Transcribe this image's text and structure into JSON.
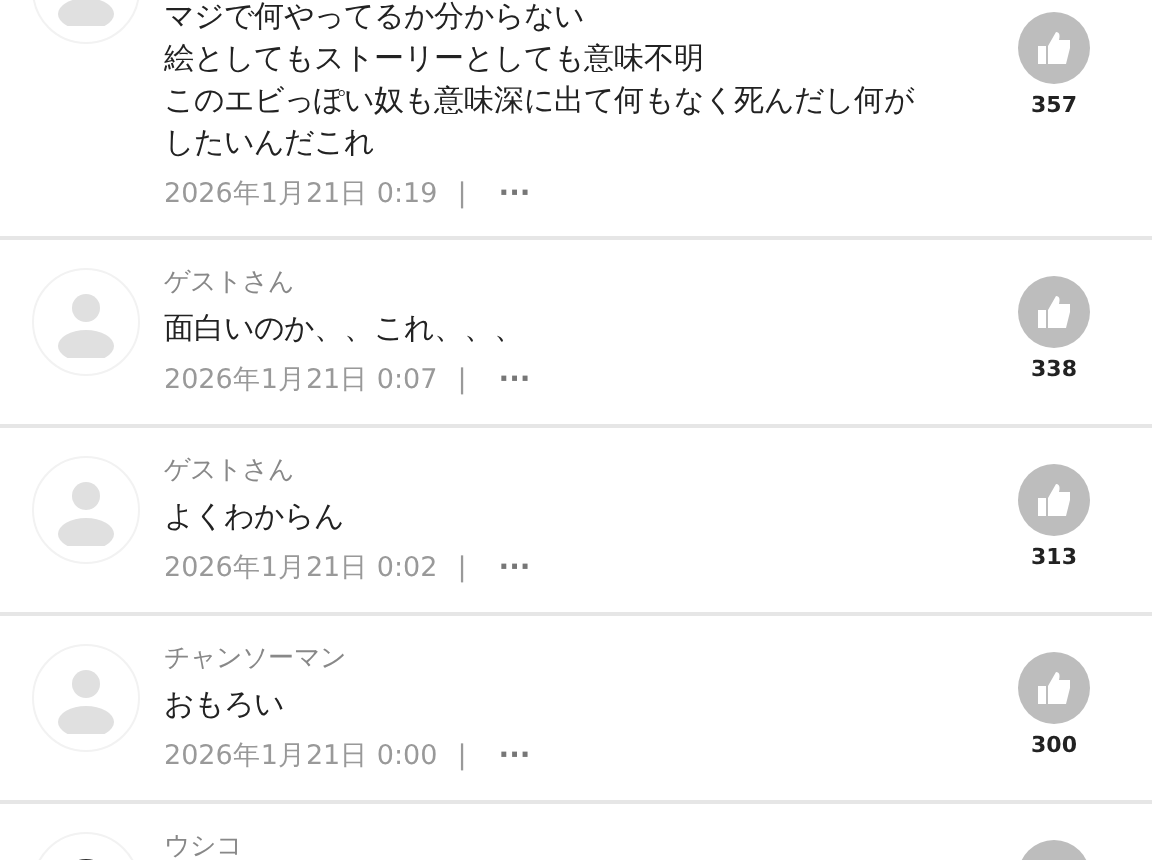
{
  "comments": [
    {
      "kind": "guest",
      "lines": [
        "マジで何やってるか分からない",
        "絵としてもストーリーとしても意味不明",
        "このエビっぽい奴も意味深に出て何もなく死んだし何がしたいんだこれ"
      ],
      "date": "2026年1月21日 0:19",
      "separator": "|",
      "more": "···",
      "likes": "357"
    },
    {
      "kind": "guest",
      "name": "ゲストさん",
      "lines": [
        "面白いのか、、これ、、、"
      ],
      "date": "2026年1月21日 0:07",
      "separator": "|",
      "more": "···",
      "likes": "338"
    },
    {
      "kind": "guest",
      "name": "ゲストさん",
      "lines": [
        "よくわからん"
      ],
      "date": "2026年1月21日 0:02",
      "separator": "|",
      "more": "···",
      "likes": "313"
    },
    {
      "kind": "guest",
      "name": "チャンソーマン",
      "lines": [
        "おもろい"
      ],
      "date": "2026年1月21日 0:00",
      "separator": "|",
      "more": "···",
      "likes": "300"
    },
    {
      "kind": "custom",
      "name": "ウシコ"
    }
  ]
}
